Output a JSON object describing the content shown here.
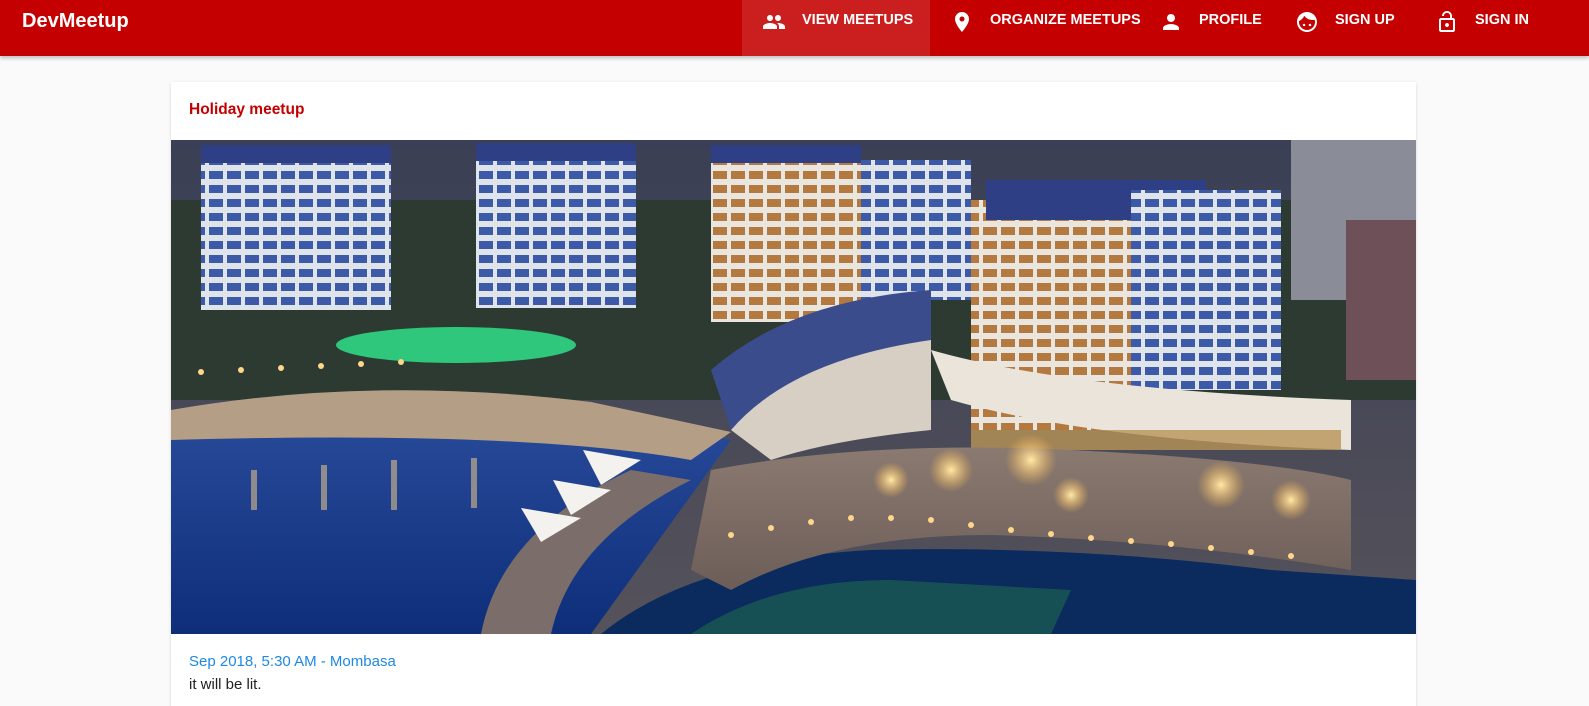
{
  "app": {
    "brand": "DevMeetup"
  },
  "nav": {
    "items": [
      {
        "label": "View Meetups",
        "icon": "people-icon",
        "active": true
      },
      {
        "label": "Organize Meetups",
        "icon": "location-pin-icon",
        "active": false
      },
      {
        "label": "Profile",
        "icon": "person-icon",
        "active": false
      },
      {
        "label": "Sign Up",
        "icon": "face-icon",
        "active": false
      },
      {
        "label": "Sign In",
        "icon": "lock-open-icon",
        "active": false
      }
    ]
  },
  "meetup": {
    "title": "Holiday meetup",
    "image_alt": "night aerial view of a waterfront resort",
    "date_location": "Sep 2018, 5:30 AM - Mombasa",
    "description": "it will be lit."
  },
  "colors": {
    "primary": "#c40000",
    "accent": "#1e88e5",
    "background": "#fafafa"
  }
}
